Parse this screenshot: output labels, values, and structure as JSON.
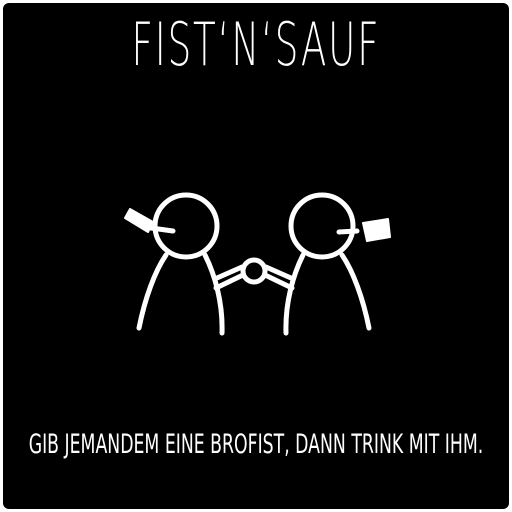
{
  "card": {
    "title": "FIST‘N‘SAUF",
    "instruction": "GIB JEMANDEM EINE BROFIST, DANN TRINK MIT IHM.",
    "illustration_icon": "two-stick-figures-fistbump-with-bottles-icon"
  },
  "colors": {
    "background": "#000000",
    "foreground": "#ffffff"
  }
}
